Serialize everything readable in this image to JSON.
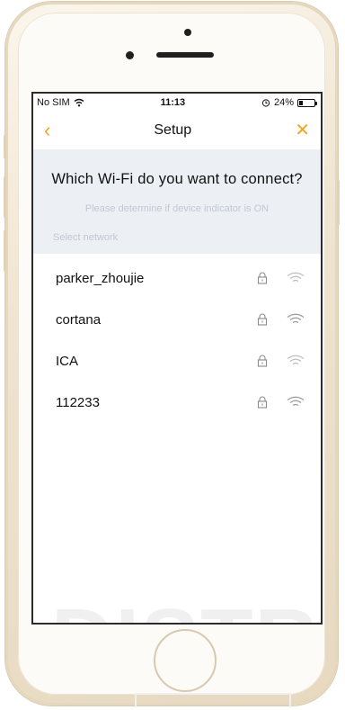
{
  "status_bar": {
    "carrier": "No SIM",
    "time": "11:13",
    "battery_percent": "24%",
    "battery_level": 0.24
  },
  "nav": {
    "title": "Setup",
    "back_icon": "chevron-left-icon",
    "close_icon": "close-icon"
  },
  "info": {
    "question": "Which Wi-Fi do you want to connect?",
    "hint": "Please determine if device indicator is ON",
    "select_label": "Select network"
  },
  "networks": [
    {
      "name": "parker_zhoujie",
      "secured": true
    },
    {
      "name": "cortana",
      "secured": true
    },
    {
      "name": "ICA",
      "secured": true
    },
    {
      "name": "112233",
      "secured": true
    }
  ],
  "watermark": "DISTRI",
  "colors": {
    "accent": "#f2a51f",
    "info_bg": "#eceff4",
    "hint_text": "#c2c8d2"
  }
}
